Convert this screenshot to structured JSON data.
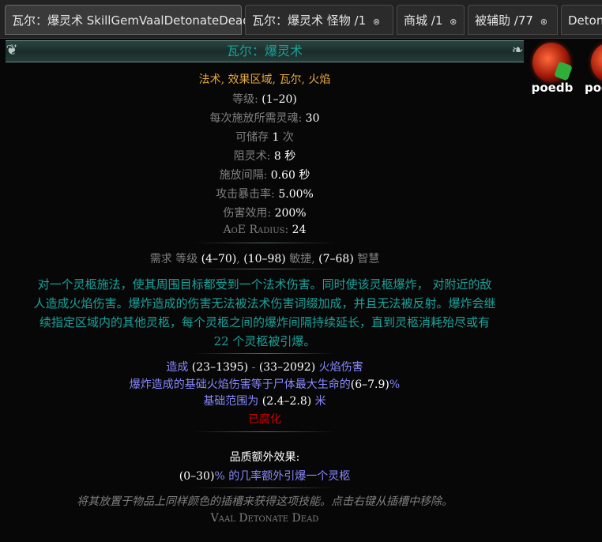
{
  "tabs": [
    {
      "label": "瓦尔：爆灵术 SkillGemVaalDetonateDead",
      "close": ""
    },
    {
      "label": "瓦尔：爆灵术 怪物 /1",
      "close": "⊗"
    },
    {
      "label": "商城 /1",
      "close": "⊗"
    },
    {
      "label": "被辅助 /77",
      "close": "⊗"
    },
    {
      "label": "Deton",
      "close": ""
    }
  ],
  "header": {
    "title": "瓦尔：爆灵术"
  },
  "gem": {
    "tags": "法术, 效果区域, 瓦尔, 火焰",
    "level_label": "等级:",
    "level_value": "(1–20)",
    "souls_label": "每次施放所需灵魂:",
    "souls_value": "30",
    "store_label": "可储存",
    "store_value": "1",
    "store_unit": "次",
    "soul_prevent_label": "阻灵术:",
    "soul_prevent_value": "8 秒",
    "interval_label": "施放间隔:",
    "interval_value": "0.60 秒",
    "crit_label": "攻击暴击率:",
    "crit_value": "5.00%",
    "effectiveness_label": "伤害效用:",
    "effectiveness_value": "200%",
    "aoe_label": "AoE Radius:",
    "aoe_value": "24",
    "req_prefix": "需求 等级",
    "req_level": "(4–70)",
    "req_dex": "(10–98)",
    "req_dex_label": "敏捷",
    "req_int": "(7–68)",
    "req_int_label": "智慧",
    "description": [
      "对一个灵柩施法，使其周围目标都受到一个法术伤害。同时使该灵柩爆炸， 对附近的敌",
      "人造成火焰伤害。爆炸造成的伤害无法被法术伤害词缀加成，并且无法被反射。爆炸会继",
      "续指定区域内的其他灵柩，每个灵柩之间的爆炸间隔持续延长，直到灵柩消耗殆尽或有",
      "22 个灵柩被引爆。"
    ],
    "mod1_pre": "造成",
    "mod1_a": "(23–1395)",
    "mod1_dash": "-",
    "mod1_b": "(33–2092)",
    "mod1_post": "火焰伤害",
    "mod2_pre": "爆炸造成的基础火焰伤害等于尸体最大生命的",
    "mod2_val": "(6–7.9)",
    "mod2_post": "%",
    "mod3_pre": "基础范围为",
    "mod3_val": "(2.4–2.8)",
    "mod3_post": "米",
    "corrupted": "已腐化",
    "quality_header": "品质额外效果:",
    "quality_val": "(0–30)",
    "quality_text": "% 的几率额外引爆一个灵柩",
    "flavor": "将其放置于物品上同样颜色的插槽来获得这项技能。点击右键从插槽中移除。",
    "footer_name": "Vaal Detonate Dead"
  },
  "thumbs": [
    {
      "label": "poedb"
    },
    {
      "label": "poe"
    }
  ],
  "colors": {
    "tags": "#e6a93c",
    "gem_text": "#1ba29b",
    "mod": "#8888ff",
    "corrupted": "#d20000"
  }
}
